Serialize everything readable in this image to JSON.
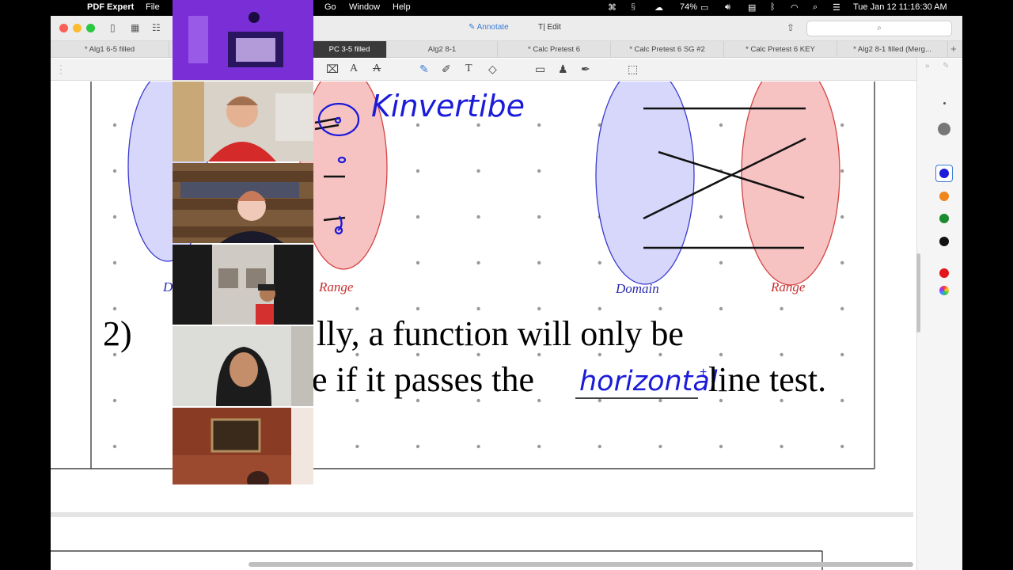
{
  "menubar": {
    "app_name": "PDF Expert",
    "menus": [
      "File",
      "Go",
      "Window",
      "Help"
    ],
    "battery": "74%",
    "datetime": "Tue Jan 12  11:16:30 AM"
  },
  "toolbar": {
    "annotate_label": "Annotate",
    "edit_label": "Edit",
    "search_placeholder": ""
  },
  "tabs": [
    {
      "label": "* Alg1 6-5 filled",
      "active": false
    },
    {
      "label": "",
      "active": false
    },
    {
      "label": "PC 3-5 filled",
      "active": true
    },
    {
      "label": "Alg2 8-1",
      "active": false
    },
    {
      "label": "* Calc Pretest 6",
      "active": false
    },
    {
      "label": "* Calc Pretest 6 SG #2",
      "active": false
    },
    {
      "label": "* Calc Pretest 6 KEY",
      "active": false
    },
    {
      "label": "* Alg2 8-1 filled (Merg...",
      "active": false
    }
  ],
  "document": {
    "handwriting_top": "Kinvertibe",
    "left_domain_label": "D",
    "left_range_label": "Range",
    "right_domain_label": "Domain",
    "right_range_label": "Range",
    "problem_number": "2)",
    "line1_visible": "lly, a function will only be",
    "line2_visible": "e if it passes the",
    "handwritten_answer": "horizontal",
    "line2_end": "line test."
  },
  "sidebar": {
    "colors": [
      "#1b1bd9",
      "#f0851c",
      "#1c8a2e",
      "#111111",
      "#e3161c"
    ]
  }
}
